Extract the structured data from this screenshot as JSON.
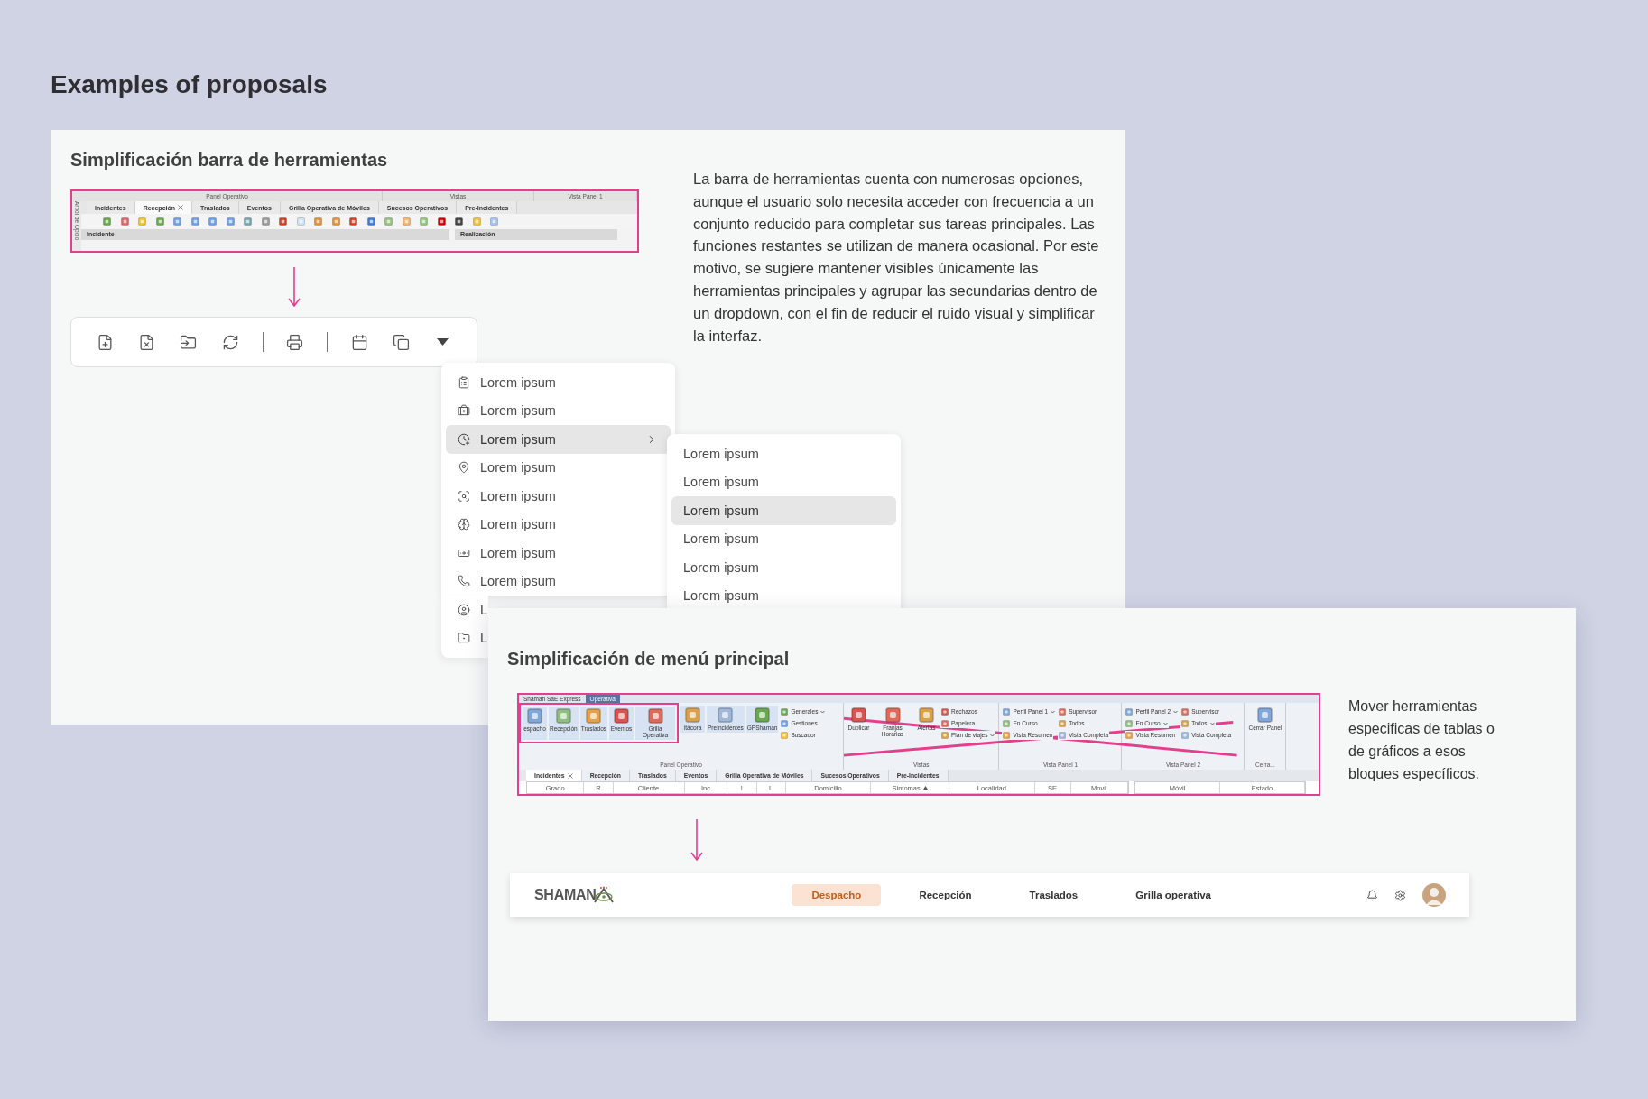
{
  "page_title": "Examples of proposals",
  "toolbar_card": {
    "title": "Simplificación barra de herramientas",
    "legacy_toolbar": {
      "groups": [
        "Panel Operativo",
        "Vistas",
        "Vista Panel 1"
      ],
      "side_label": "Arbol de Opcio",
      "tabs": [
        {
          "label": "Incidentes",
          "selected": false
        },
        {
          "label": "Recepción",
          "selected": true
        },
        {
          "label": "Traslados",
          "selected": false
        },
        {
          "label": "Eventos",
          "selected": false
        },
        {
          "label": "Grilla Operativa de Móviles",
          "selected": false
        },
        {
          "label": "Sucesos Operativos",
          "selected": false
        },
        {
          "label": "Pre-Incidentes",
          "selected": false
        }
      ],
      "panels": [
        "Incidente",
        "Realización"
      ]
    },
    "description": "La barra de herramientas cuenta con numerosas opciones, aunque el usuario solo necesita acceder con frecuencia a un conjunto reducido para completar sus tareas principales. Las funciones restantes se utilizan de manera ocasional. Por este motivo, se sugiere mantener visibles únicamente las herramientas principales y agrupar las secundarias dentro de un dropdown, con el fin de reducir el ruido visual y simplificar la interfaz.",
    "dropdown": {
      "items": [
        {
          "label": "Lorem ipsum",
          "selected": false,
          "submenu": false
        },
        {
          "label": "Lorem ipsum",
          "selected": false,
          "submenu": false
        },
        {
          "label": "Lorem ipsum",
          "selected": true,
          "submenu": true
        },
        {
          "label": "Lorem ipsum",
          "selected": false,
          "submenu": false
        },
        {
          "label": "Lorem ipsum",
          "selected": false,
          "submenu": false
        },
        {
          "label": "Lorem ipsum",
          "selected": false,
          "submenu": false
        },
        {
          "label": "Lorem ipsum",
          "selected": false,
          "submenu": false
        },
        {
          "label": "Lorem ipsum",
          "selected": false,
          "submenu": false
        },
        {
          "label": "L",
          "selected": false,
          "submenu": false
        },
        {
          "label": "L",
          "selected": false,
          "submenu": false
        }
      ]
    },
    "submenu": {
      "items": [
        {
          "label": "Lorem ipsum",
          "selected": false
        },
        {
          "label": "Lorem ipsum",
          "selected": false
        },
        {
          "label": "Lorem ipsum",
          "selected": true
        },
        {
          "label": "Lorem ipsum",
          "selected": false
        },
        {
          "label": "Lorem ipsum",
          "selected": false
        },
        {
          "label": "Lorem ipsum",
          "selected": false
        }
      ]
    }
  },
  "menu_card": {
    "title": "Simplificación de menú principal",
    "legacy_ribbon": {
      "app_tabs": [
        {
          "label": "Shaman SaE Express",
          "selected": false
        },
        {
          "label": "Operativa",
          "selected": true
        }
      ],
      "groups": [
        {
          "label": "Panel Operativo",
          "crossed_out": false,
          "buttons": [
            {
              "label": "espacho",
              "kind": "large",
              "highlighted": true
            },
            {
              "label": "Recepción",
              "kind": "large",
              "highlighted": true
            },
            {
              "label": "Traslados",
              "kind": "large",
              "highlighted": true
            },
            {
              "label": "Eventos",
              "kind": "large",
              "highlighted": true
            },
            {
              "label": "Grilla Operativa",
              "kind": "large",
              "highlighted": true
            },
            {
              "label": "itácora",
              "kind": "large",
              "highlighted": false
            },
            {
              "label": "PreIncidentes",
              "kind": "large",
              "highlighted": false
            },
            {
              "label": "GPShaman",
              "kind": "large",
              "highlighted": false
            },
            {
              "label": "Generales",
              "kind": "small",
              "menu": true
            },
            {
              "label": "Gestiones",
              "kind": "small",
              "menu": false
            },
            {
              "label": "Buscador",
              "kind": "small",
              "menu": false
            }
          ]
        },
        {
          "label": "Vistas",
          "crossed_out": true,
          "buttons": [
            {
              "label": "Duplicar",
              "kind": "large",
              "highlighted": false
            },
            {
              "label": "Franjas Horarias",
              "kind": "large",
              "highlighted": false
            },
            {
              "label": "Alertas",
              "kind": "large",
              "highlighted": false
            },
            {
              "label": "Rechazos",
              "kind": "small",
              "menu": false
            },
            {
              "label": "Papelera",
              "kind": "small",
              "menu": false
            },
            {
              "label": "Plan de viajes",
              "kind": "small",
              "menu": true
            }
          ]
        },
        {
          "label": "Vista Panel 1",
          "crossed_out": true,
          "buttons": [
            {
              "label": "Perfil Panel 1",
              "kind": "small",
              "menu": true
            },
            {
              "label": "En Curso",
              "kind": "small",
              "menu": false
            },
            {
              "label": "Vista Resumen",
              "kind": "small",
              "menu": false
            },
            {
              "label": "Supervisor",
              "kind": "small",
              "menu": false
            },
            {
              "label": "Todos",
              "kind": "small",
              "menu": false
            },
            {
              "label": "Vista Completa",
              "kind": "small",
              "menu": false
            }
          ]
        },
        {
          "label": "Vista Panel 2",
          "crossed_out": true,
          "buttons": [
            {
              "label": "Perfil Panel 2",
              "kind": "small",
              "menu": true
            },
            {
              "label": "En Curso",
              "kind": "small",
              "menu": true
            },
            {
              "label": "Vista Resumen",
              "kind": "small",
              "menu": false
            },
            {
              "label": "Supervisor",
              "kind": "small",
              "menu": false
            },
            {
              "label": "Todos",
              "kind": "small",
              "menu": true
            },
            {
              "label": "Vista Completa",
              "kind": "small",
              "menu": false
            }
          ]
        },
        {
          "label": "Cerra...",
          "crossed_out": false,
          "buttons": [
            {
              "label": "Cerrar Panel",
              "kind": "large",
              "highlighted": false
            }
          ]
        }
      ],
      "tabs": [
        {
          "label": "Incidentes",
          "selected": true
        },
        {
          "label": "Recepción",
          "selected": false
        },
        {
          "label": "Traslados",
          "selected": false
        },
        {
          "label": "Eventos",
          "selected": false
        },
        {
          "label": "Grilla Operativa de Móviles",
          "selected": false
        },
        {
          "label": "Sucesos Operativos",
          "selected": false
        },
        {
          "label": "Pre-Incidentes",
          "selected": false
        }
      ],
      "columns": [
        {
          "label": "Grado",
          "sorted": false
        },
        {
          "label": "R",
          "sorted": false
        },
        {
          "label": "Cliente",
          "sorted": false
        },
        {
          "label": "Inc",
          "sorted": false
        },
        {
          "label": "!",
          "sorted": false
        },
        {
          "label": "L",
          "sorted": false
        },
        {
          "label": "Domicilio",
          "sorted": false
        },
        {
          "label": "Sintomas",
          "sorted": true
        },
        {
          "label": "Localidad",
          "sorted": false
        },
        {
          "label": "SE",
          "sorted": false
        },
        {
          "label": "Movil",
          "sorted": false
        }
      ],
      "columns_2": [
        "Móvil",
        "Estado"
      ]
    },
    "note": "Mover herramientas especificas de tablas o de gráficos a esos bloques específicos.",
    "navbar": {
      "logo": "SHAMAN",
      "tabs": [
        {
          "label": "Despacho",
          "selected": true
        },
        {
          "label": "Recepción",
          "selected": false
        },
        {
          "label": "Traslados",
          "selected": false
        },
        {
          "label": "Grilla operativa",
          "selected": false
        }
      ]
    }
  }
}
